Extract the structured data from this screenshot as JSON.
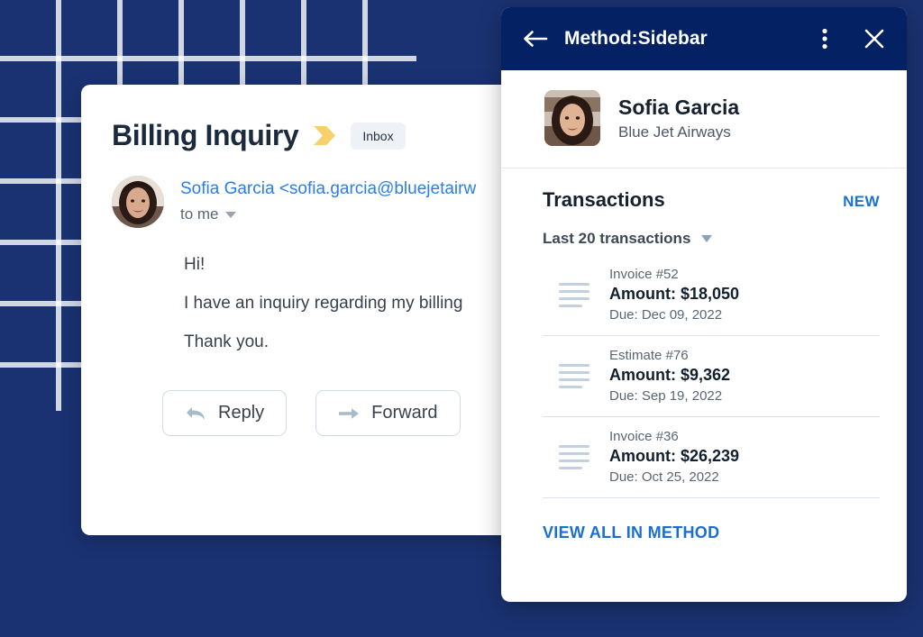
{
  "background": {
    "color": "#1b3272",
    "grid_line_color": "#ffffff"
  },
  "email_card": {
    "subject": "Billing Inquiry",
    "important_marker_icon": "yellow-chevron-icon",
    "label": "Inbox",
    "sender_avatar_icon": "sofia-garcia-avatar",
    "sender_line": "Sofia Garcia <sofia.garcia@bluejetairw",
    "recipient": "to me",
    "recipient_caret_icon": "caret-down-icon",
    "body_lines": [
      "Hi!",
      "I have an inquiry regarding my billing",
      "Thank you."
    ],
    "actions": [
      {
        "label": "Reply",
        "icon": "reply-arrow-icon"
      },
      {
        "label": "Forward",
        "icon": "forward-arrow-icon"
      }
    ]
  },
  "sidebar": {
    "header": {
      "title": "Method:Sidebar",
      "back_icon": "arrow-left-icon",
      "more_icon": "more-vertical-icon",
      "close_icon": "close-x-icon",
      "background_color": "#042163"
    },
    "contact": {
      "avatar_icon": "sofia-garcia-avatar",
      "name": "Sofia Garcia",
      "company": "Blue Jet Airways"
    },
    "transactions": {
      "title": "Transactions",
      "new_label": "NEW",
      "new_color": "#1a73d0",
      "filter_label": "Last 20 transactions",
      "filter_caret_icon": "caret-down-icon",
      "items": [
        {
          "reference": "Invoice #52",
          "amount": "Amount: $18,050",
          "due": "Due: Dec 09, 2022",
          "icon": "document-lines-icon"
        },
        {
          "reference": "Estimate #76",
          "amount": "Amount: $9,362",
          "due": "Due: Sep 19, 2022",
          "icon": "document-lines-icon"
        },
        {
          "reference": "Invoice #36",
          "amount": "Amount: $26,239",
          "due": "Due: Oct 25, 2022",
          "icon": "document-lines-icon"
        }
      ],
      "view_all_label": "VIEW ALL IN METHOD",
      "view_all_color": "#1a6fd0"
    }
  }
}
